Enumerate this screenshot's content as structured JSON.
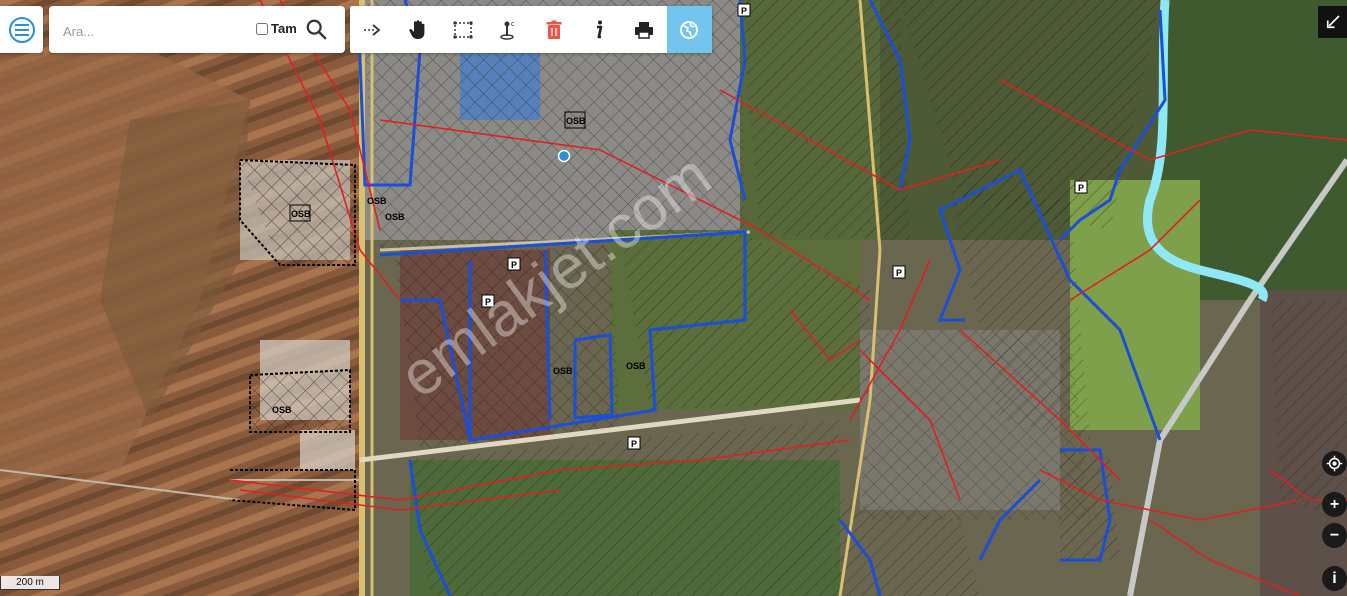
{
  "search": {
    "placeholder": "Ara...",
    "tam_label": "Tam",
    "tam_checked": false
  },
  "toolbar": {
    "tools": [
      {
        "icon": "arrow-right-icon",
        "active": false
      },
      {
        "icon": "hand-pan-icon",
        "active": false
      },
      {
        "icon": "select-area-icon",
        "active": false
      },
      {
        "icon": "location-pin-icon",
        "active": false
      },
      {
        "icon": "trash-icon",
        "active": false
      },
      {
        "icon": "info-icon",
        "active": false
      },
      {
        "icon": "print-icon",
        "active": false
      },
      {
        "icon": "layers-globe-icon",
        "active": true
      }
    ]
  },
  "map": {
    "zone_labels": [
      "OSB",
      "OSB",
      "OSB",
      "OSB",
      "OSB",
      "OSB",
      "OSB"
    ],
    "parking_labels": [
      "P",
      "P",
      "P",
      "P",
      "P",
      "P"
    ],
    "watermark": "emlakjet.com",
    "scale_label": "200 m",
    "colors": {
      "parcel_blue": "#1a4fd6",
      "plan_red": "#e02020",
      "hatch_black": "#111111",
      "river_cyan": "#8ee8f5",
      "road_yellow": "#d8c070",
      "active_tool": "#73c4ee"
    }
  },
  "controls": {
    "locate_icon": "target-icon",
    "zoom_in_label": "+",
    "zoom_out_label": "−",
    "info_label": "i",
    "fullscreen_icon": "collapse-arrow-icon"
  }
}
